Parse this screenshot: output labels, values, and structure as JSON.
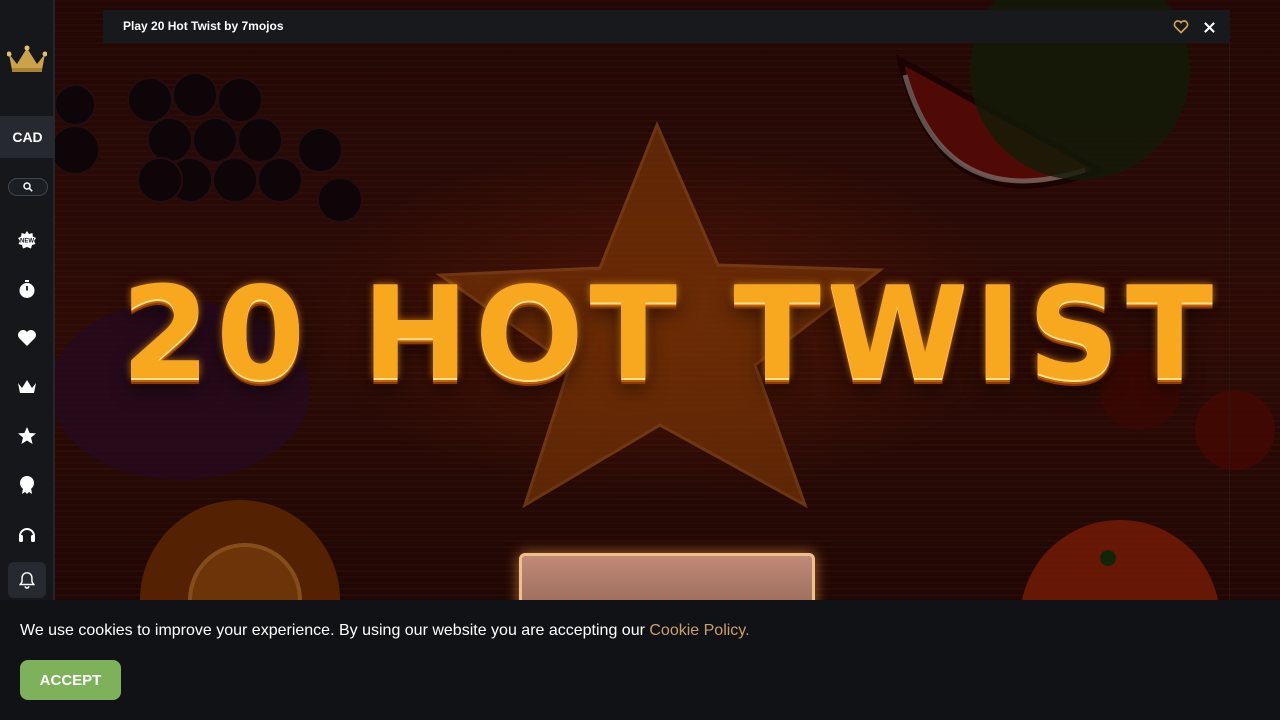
{
  "window": {
    "title": "Play 20 Hot Twist by 7mojos"
  },
  "game": {
    "logo_text": "20 HOT TWIST"
  },
  "sidebar": {
    "currency": "CAD",
    "items": [
      {
        "name": "new-games",
        "icon": "new-badge-icon"
      },
      {
        "name": "recent",
        "icon": "stopwatch-icon"
      },
      {
        "name": "favorites",
        "icon": "heart-icon"
      },
      {
        "name": "vip",
        "icon": "crown-icon"
      },
      {
        "name": "top",
        "icon": "star-icon"
      },
      {
        "name": "rewards",
        "icon": "award-ribbon-icon"
      },
      {
        "name": "support",
        "icon": "headset-icon"
      },
      {
        "name": "notifications",
        "icon": "bell-icon"
      }
    ]
  },
  "cookie": {
    "message": "We use cookies to improve your experience. By using our website you are accepting our ",
    "link_text": "Cookie Policy.",
    "accept_label": "ACCEPT"
  },
  "colors": {
    "accent_gold": "#d4a84a",
    "accept_green": "#7db25a",
    "link_tan": "#c9a06c",
    "sidebar_bg": "#15171b"
  }
}
